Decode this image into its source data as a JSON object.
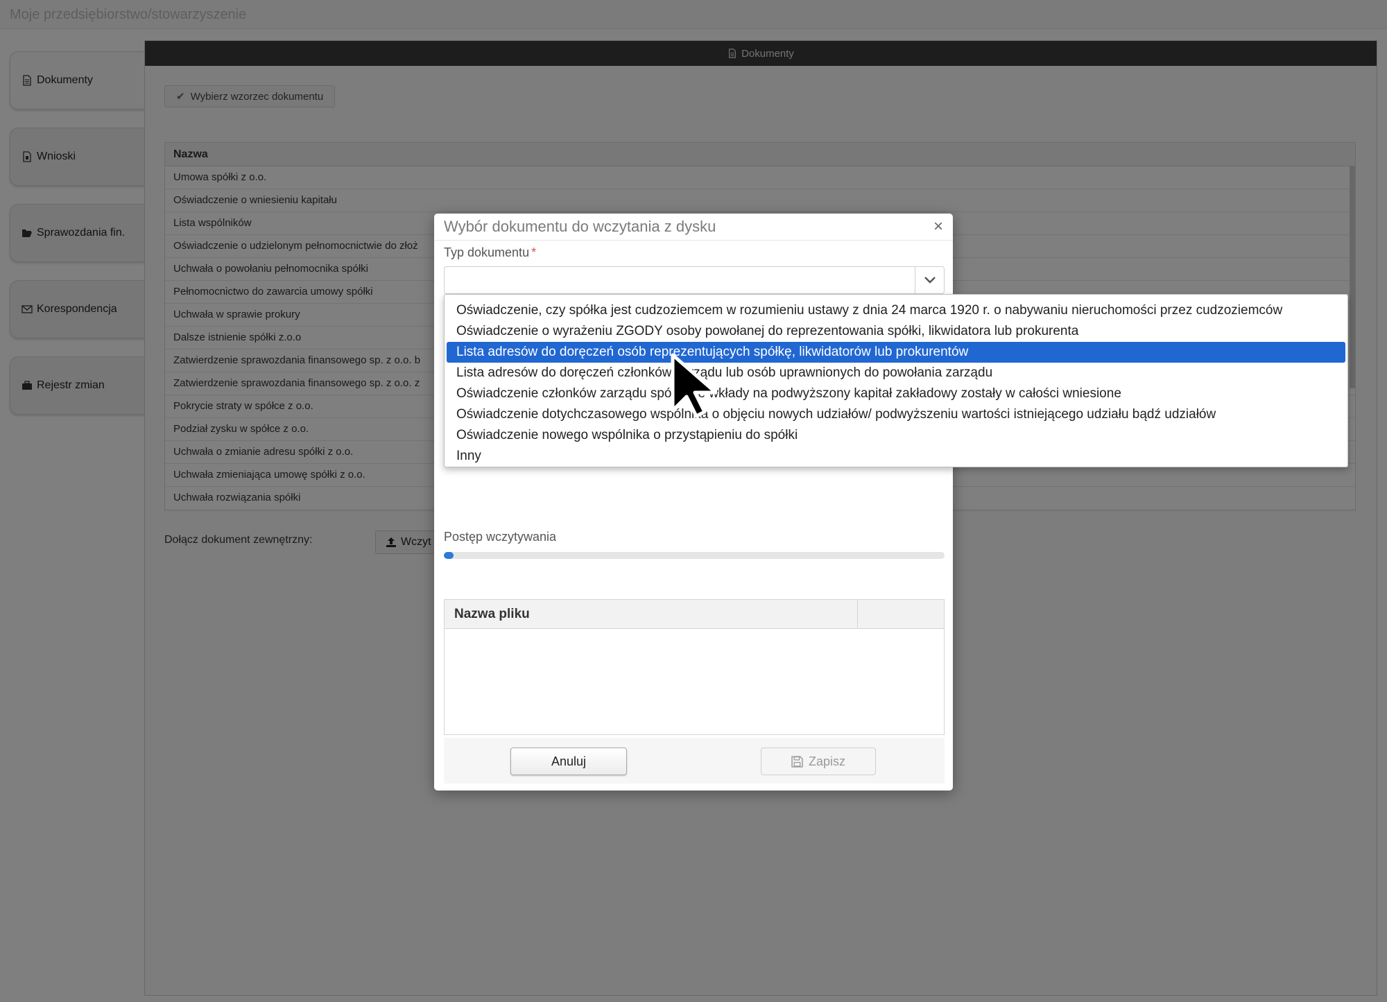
{
  "app": {
    "title": "Moje przedsiębiorstwo/stowarzyszenie"
  },
  "sidebar": {
    "items": [
      {
        "label": "Dokumenty",
        "icon": "document-icon",
        "active": true
      },
      {
        "label": "Wnioski",
        "icon": "request-document-icon",
        "active": false
      },
      {
        "label": "Sprawozdania fin.",
        "icon": "folder-open-icon",
        "active": false
      },
      {
        "label": "Korespondencja",
        "icon": "envelope-icon",
        "active": false
      },
      {
        "label": "Rejestr zmian",
        "icon": "briefcase-icon",
        "active": false
      }
    ]
  },
  "panel": {
    "title": "Dokumenty",
    "pick_template_button": "Wybierz wzorzec dokumentu",
    "table": {
      "header": "Nazwa",
      "rows": [
        "Umowa spółki z o.o.",
        "Oświadczenie o wniesieniu kapitału",
        "Lista wspólników",
        "Oświadczenie o udzielonym pełnomocnictwie do złoż",
        "Uchwała o powołaniu pełnomocnika spółki",
        "Pełnomocnictwo do zawarcia umowy spółki",
        "Uchwała w sprawie prokury",
        "Dalsze istnienie spółki z.o.o",
        "Zatwierdzenie sprawozdania finansowego sp. z o.o. b",
        "Zatwierdzenie sprawozdania finansowego sp. z o.o. z",
        "Pokrycie straty w spółce z o.o.",
        "Podział zysku w spółce z o.o.",
        "Uchwała o zmianie adresu spółki z o.o.",
        "Uchwała zmieniająca umowę spółki z o.o.",
        "Uchwała rozwiązania spółki"
      ]
    },
    "attach_label": "Dołącz dokument zewnętrzny:",
    "upload_button": "Wczyt"
  },
  "modal": {
    "title": "Wybór dokumentu do wczytania z dysku",
    "type_label": "Typ dokumentu",
    "required_mark": "*",
    "select_value": "",
    "dropdown_options": [
      "Oświadczenie, czy spółka jest cudzoziemcem w rozumieniu ustawy z dnia 24 marca 1920 r. o nabywaniu nieruchomości przez cudzoziemców",
      "Oświadczenie o wyrażeniu ZGODY osoby powołanej do reprezentowania spółki, likwidatora lub prokurenta",
      "Lista adresów do doręczeń osób reprezentujących spółkę, likwidatorów lub prokurentów",
      "Lista adresów do doręczeń członków zarządu lub osób uprawnionych do powołania zarządu",
      "Oświadczenie członków zarządu spółki, że wkłady na podwyższony kapitał zakładowy zostały w całości wniesione",
      "Oświadczenie dotychczasowego wspólnika o objęciu nowych udziałów/ podwyższeniu wartości istniejącego udziału bądź udziałów",
      "Oświadczenie nowego wspólnika o przystąpieniu do spółki",
      "Inny"
    ],
    "highlighted_option_index": 2,
    "progress_label": "Postęp wczytywania",
    "progress_value": 0.02,
    "file_table_header": "Nazwa pliku",
    "cancel_button": "Anuluj",
    "save_button": "Zapisz"
  },
  "colors": {
    "accent": "#2167d2",
    "header_bar": "#3a3a3a",
    "required": "#d9534f"
  }
}
